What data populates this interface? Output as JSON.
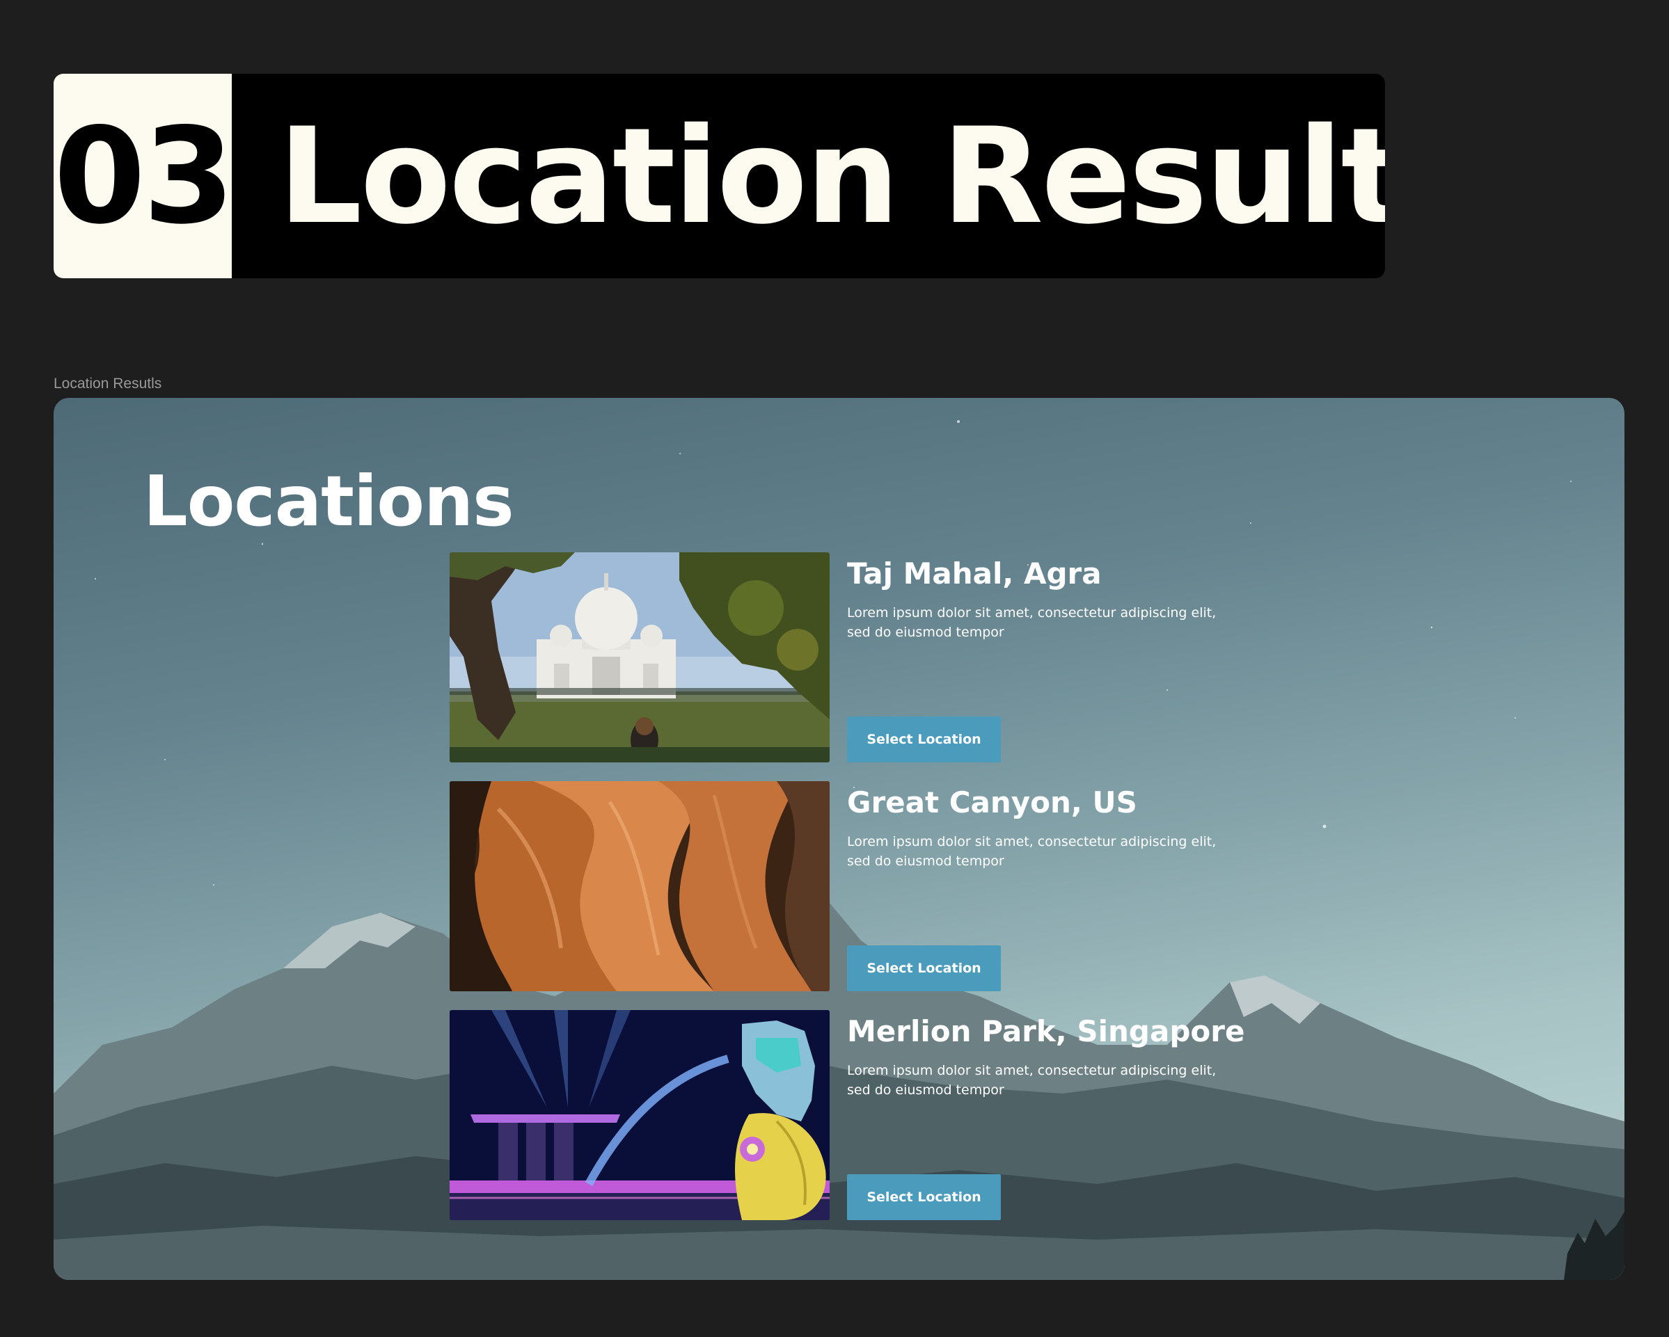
{
  "section": {
    "number": "03",
    "title": "Location Results"
  },
  "frame_label": "Location Resutls",
  "page": {
    "title": "Locations",
    "locations": [
      {
        "name": "Taj Mahal, Agra",
        "description": "Lorem ipsum dolor sit amet, consectetur adipiscing elit, sed do eiusmod tempor",
        "button_label": "Select Location",
        "image": "taj-mahal-photo"
      },
      {
        "name": "Great Canyon, US",
        "description": "Lorem ipsum dolor sit amet, consectetur adipiscing elit, sed do eiusmod tempor",
        "button_label": "Select Location",
        "image": "canyon-photo"
      },
      {
        "name": "Merlion Park, Singapore",
        "description": "Lorem ipsum dolor sit amet, consectetur adipiscing elit, sed do eiusmod tempor",
        "button_label": "Select Location",
        "image": "merlion-photo"
      }
    ]
  },
  "colors": {
    "canvas": "#1e1e1e",
    "header_bg": "#000000",
    "header_text": "#fdfbef",
    "button_bg": "#4a9bbc",
    "button_text": "#ffffff"
  }
}
